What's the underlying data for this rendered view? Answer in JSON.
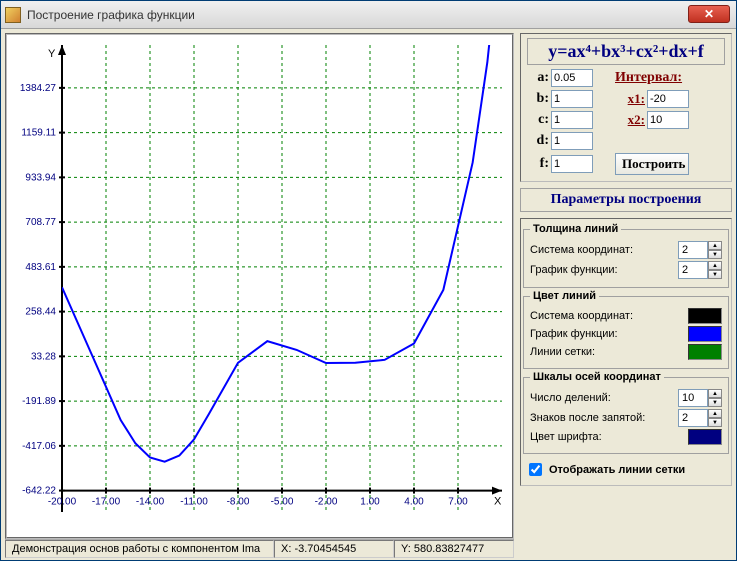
{
  "window": {
    "title": "Построение графика функции"
  },
  "formula": "y=ax⁴+bx³+cx²+dx+f",
  "coef": {
    "labels": {
      "a": "a:",
      "b": "b:",
      "c": "c:",
      "d": "d:",
      "f": "f:"
    },
    "values": {
      "a": "0.05",
      "b": "1",
      "c": "1",
      "d": "1",
      "f": "1"
    }
  },
  "interval": {
    "title": "Интервал:",
    "x1_label": "x1:",
    "x1": "-20",
    "x2_label": "x2:",
    "x2": "10"
  },
  "build_button": "Построить",
  "params_title": "Параметры построения",
  "thickness": {
    "legend": "Толщина линий",
    "sys_label": "Система координат:",
    "sys_val": "2",
    "func_label": "График функции:",
    "func_val": "2"
  },
  "colors_panel": {
    "legend": "Цвет линий",
    "sys_label": "Система координат:",
    "sys_color": "#000000",
    "func_label": "График функции:",
    "func_color": "#0000ff",
    "grid_label": "Линии сетки:",
    "grid_color": "#008000"
  },
  "scales": {
    "legend": "Шкалы осей координат",
    "div_label": "Число делений:",
    "div_val": "10",
    "dec_label": "Знаков после запятой:",
    "dec_val": "2",
    "font_label": "Цвет шрифта:",
    "font_color": "#000080"
  },
  "show_grid": {
    "label": "Отображать линии сетки",
    "checked": true
  },
  "status": {
    "demo": "Демонстрация основ работы с компонентом Ima",
    "x": "X: -3.70454545",
    "y": "Y: 580.83827477"
  },
  "chart_data": {
    "type": "line",
    "x_ticks": [
      "-20.00",
      "-17.00",
      "-14.00",
      "-11.00",
      "-8.00",
      "-5.00",
      "-2.00",
      "1.00",
      "4.00",
      "7.00"
    ],
    "y_ticks": [
      "-642.22",
      "-417.06",
      "-191.89",
      "33.28",
      "258.44",
      "483.61",
      "708.77",
      "933.94",
      "1159.11",
      "1384.27"
    ],
    "xlabel": "X",
    "ylabel": "Y",
    "x_range": [
      -20,
      10
    ],
    "y_range": [
      -750,
      1600
    ],
    "series": [
      {
        "name": "y=0.05x^4+x^3+x^2+x+1",
        "color": "#0000ff",
        "x": [
          -20,
          -18,
          -16,
          -15,
          -14,
          -13,
          -12,
          -11,
          -10,
          -8,
          -6,
          -4,
          -2,
          0,
          2,
          4,
          6,
          8,
          9,
          10
        ],
        "y": [
          381,
          46.8,
          -287,
          -404,
          -475.8,
          -497,
          -466,
          -384.6,
          -259,
          1,
          109.8,
          65.8,
          -0.2,
          1,
          15.8,
          97.8,
          367.8,
          1009,
          1513.45,
          2211
        ]
      }
    ],
    "grid": true,
    "axes_color": "#000000",
    "grid_color": "#008000"
  }
}
